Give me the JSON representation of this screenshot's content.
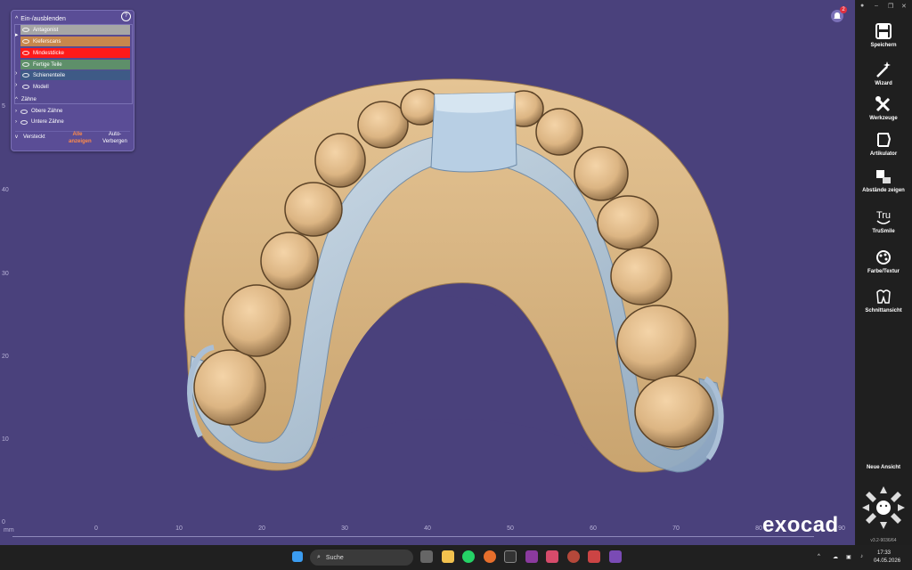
{
  "panel": {
    "header": "Ein-/ausblenden",
    "layers": [
      {
        "label": "Antagonist",
        "color": "#a6a6a6"
      },
      {
        "label": "Kieferscans",
        "color": "#c8874c"
      },
      {
        "label": "Mindestdicke",
        "color": "#ff1a1a"
      },
      {
        "label": "Fertige Teile",
        "color": "#5e8f6a"
      },
      {
        "label": "Schienenteile",
        "color": "#3e5a86"
      },
      {
        "label": "Modell",
        "color": "#574b92"
      }
    ],
    "teeth_section": "Zähne",
    "teeth_items": [
      "Obere Zähne",
      "Untere Zähne"
    ],
    "footer": {
      "hidden": "Versteckt",
      "show_all_line1": "Alle",
      "show_all_line2": "anzeigen",
      "auto_hide_line1": "Auto-",
      "auto_hide_line2": "Verbergen"
    }
  },
  "ruler": {
    "left_ticks": [
      "5",
      "40",
      "30",
      "20",
      "10",
      "0"
    ],
    "bottom_unit": "mm",
    "bottom_ticks": [
      "0",
      "10",
      "20",
      "30",
      "40",
      "50",
      "60",
      "70",
      "80",
      "90"
    ]
  },
  "notification_count": "2",
  "logo": "exocad",
  "sidebar": {
    "tools": [
      {
        "label": "Speichern",
        "icon": "save-icon"
      },
      {
        "label": "Wizard",
        "icon": "magic-wand-icon"
      },
      {
        "label": "Werkzeuge",
        "icon": "tools-icon"
      },
      {
        "label": "Artikulator",
        "icon": "articulator-icon"
      },
      {
        "label": "Abstände zeigen",
        "icon": "distance-icon"
      },
      {
        "label": "TruSmile",
        "icon": "trusmile-icon"
      },
      {
        "label": "Farbe/Textur",
        "icon": "palette-icon"
      },
      {
        "label": "Schnittansicht",
        "icon": "section-view-icon"
      }
    ],
    "trusmile_glyph": "Tru",
    "new_view": "Neue Ansicht",
    "version": "v3.2-9036/64"
  },
  "taskbar": {
    "search_placeholder": "Suche",
    "time": "17:33",
    "date": "04.05.2026"
  }
}
